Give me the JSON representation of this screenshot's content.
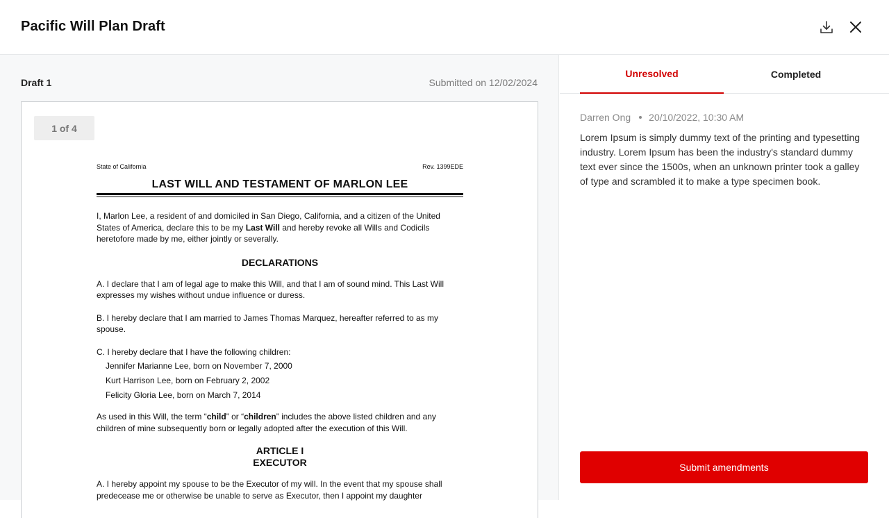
{
  "header": {
    "title": "Pacific Will Plan Draft",
    "download_icon": "download-icon",
    "close_icon": "close-icon"
  },
  "draft": {
    "label": "Draft 1",
    "submitted": "Submitted on 12/02/2024",
    "page_indicator": "1 of 4"
  },
  "document": {
    "state": "State of California",
    "rev": "Rev. 1399EDE",
    "title": "LAST WILL AND TESTAMENT OF MARLON LEE",
    "intro_pre": "I, Marlon Lee, a resident of and domiciled in San Diego, California, and a citizen of the United States of America, declare this to be my ",
    "intro_bold": "Last Will",
    "intro_post": " and hereby revoke all Wills and Codicils heretofore made by me, either jointly or severally.",
    "declarations_heading": "DECLARATIONS",
    "decl_a": "A. I declare that I am of legal age to make this Will, and that I am of sound mind. This Last Will expresses my wishes without undue influence or duress.",
    "decl_b": "B. I hereby declare that I am married to James Thomas Marquez, hereafter referred to as my spouse.",
    "decl_c": "C. I hereby declare that I have the following children:",
    "children": [
      "Jennifer Marianne Lee, born on November 7, 2000",
      "Kurt Harrison Lee, born on February 2, 2002",
      "Felicity Gloria Lee, born on March 7, 2014"
    ],
    "child_term_pre": "As used in this Will, the term “",
    "child_term_bold1": "child",
    "child_term_mid": "” or “",
    "child_term_bold2": "children",
    "child_term_post": "” includes the above listed children and any children of mine subsequently born or legally adopted after the execution of this Will.",
    "article_heading": "ARTICLE I",
    "article_subheading": "EXECUTOR",
    "article_a": "A. I hereby appoint my spouse to be the Executor of my will. In the event that my spouse shall predecease me or otherwise be unable to serve as Executor, then I appoint my daughter"
  },
  "tabs": {
    "unresolved": "Unresolved",
    "completed": "Completed"
  },
  "comment": {
    "author": "Darren Ong",
    "timestamp": "20/10/2022, 10:30 AM",
    "body": "Lorem Ipsum is simply dummy text of the printing and typesetting industry. Lorem Ipsum has been the industry's standard dummy text ever since the 1500s, when an unknown printer took a galley of type and scrambled it to make a type specimen book."
  },
  "actions": {
    "submit_label": "Submit amendments"
  },
  "colors": {
    "accent": "#e00000",
    "tab_active": "#d10000"
  }
}
